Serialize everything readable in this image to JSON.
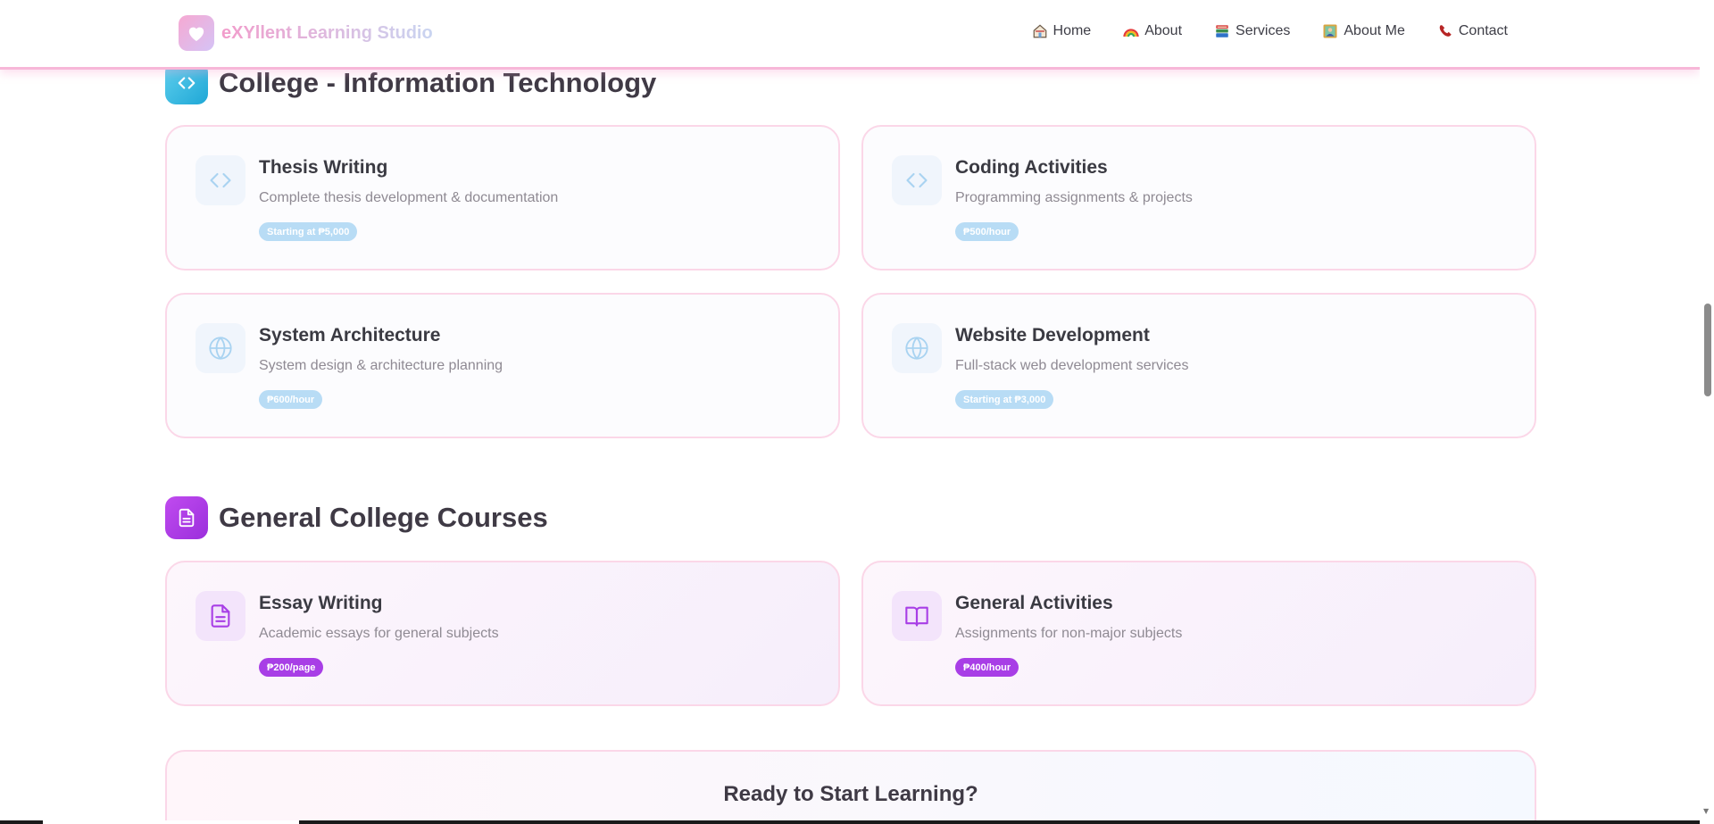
{
  "header": {
    "brand_name": "eXYllent Learning Studio",
    "nav": [
      {
        "label": "Home",
        "icon": "house-icon"
      },
      {
        "label": "About",
        "icon": "rainbow-icon"
      },
      {
        "label": "Services",
        "icon": "books-icon"
      },
      {
        "label": "About Me",
        "icon": "portrait-icon"
      },
      {
        "label": "Contact",
        "icon": "telephone-icon"
      }
    ]
  },
  "sections": [
    {
      "title": "College - Information Technology",
      "icon": "code-icon",
      "accent": "#2bb8e0",
      "cards": [
        {
          "title": "Thesis Writing",
          "description": "Complete thesis development & documentation",
          "badge": "Starting at ₱5,000",
          "icon": "code-icon"
        },
        {
          "title": "Coding Activities",
          "description": "Programming assignments & projects",
          "badge": "₱500/hour",
          "icon": "code-icon"
        },
        {
          "title": "System Architecture",
          "description": "System design & architecture planning",
          "badge": "₱600/hour",
          "icon": "globe-icon"
        },
        {
          "title": "Website Development",
          "description": "Full-stack web development services",
          "badge": "Starting at ₱3,000",
          "icon": "globe-icon"
        }
      ]
    },
    {
      "title": "General College Courses",
      "icon": "document-icon",
      "accent": "#a83ee6",
      "cards": [
        {
          "title": "Essay Writing",
          "description": "Academic essays for general subjects",
          "badge": "₱200/page",
          "icon": "document-icon"
        },
        {
          "title": "General Activities",
          "description": "Assignments for non-major subjects",
          "badge": "₱400/hour",
          "icon": "open-book-icon"
        }
      ]
    }
  ],
  "cta": {
    "title": "Ready to Start Learning?"
  },
  "colors": {
    "brand_pink": "#f29ccb",
    "it_badge": "#b8dcf5",
    "general_badge": "#a83ee6",
    "card_border": "#fbd7e8"
  }
}
